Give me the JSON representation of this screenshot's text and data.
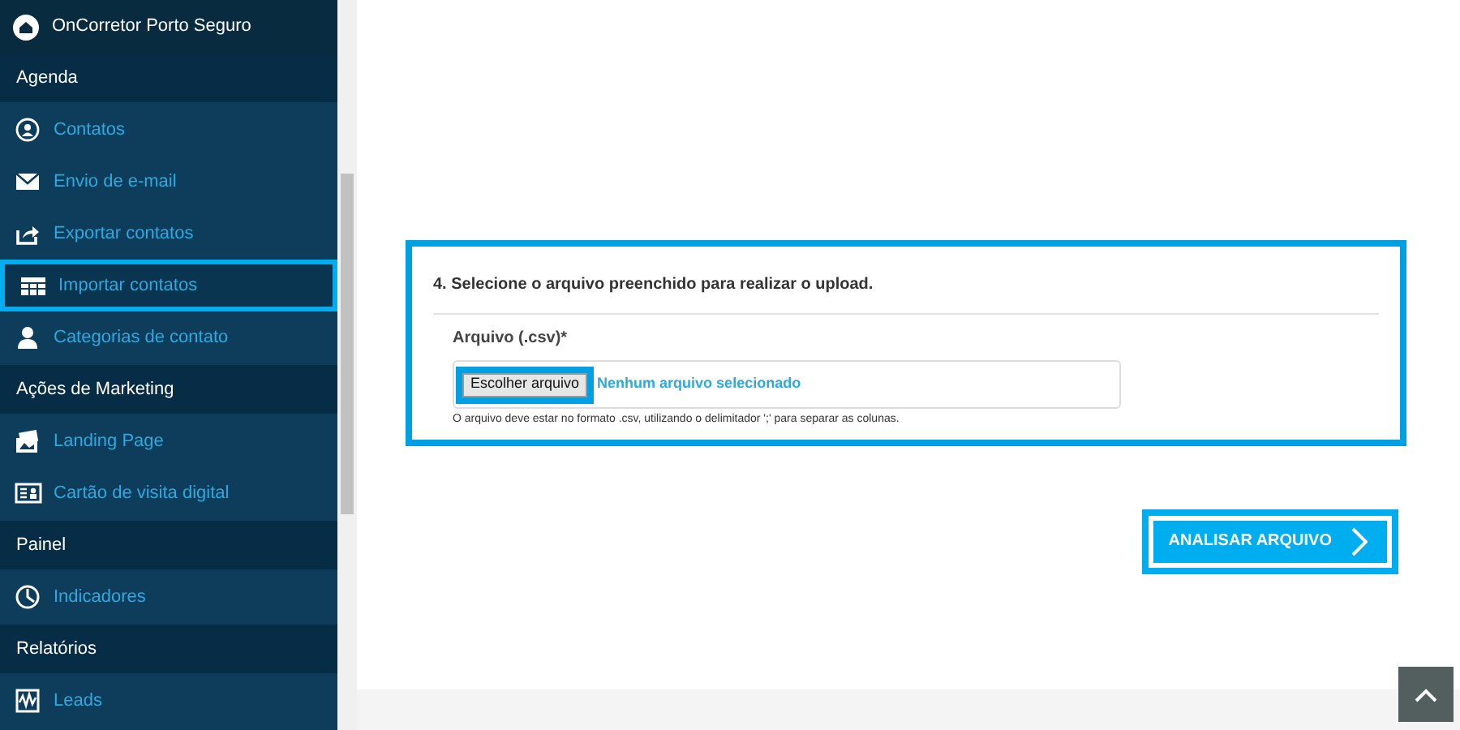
{
  "sidebar": {
    "title": "OnCorretor Porto Seguro",
    "groups": [
      {
        "label": "Agenda",
        "items": [
          {
            "label": "Contatos",
            "kind": "contacts",
            "highlighted": false
          },
          {
            "label": "Envio de e-mail",
            "kind": "email",
            "highlighted": false
          },
          {
            "label": "Exportar contatos",
            "kind": "export",
            "highlighted": false
          },
          {
            "label": "Importar contatos",
            "kind": "import",
            "highlighted": true
          },
          {
            "label": "Categorias de contato",
            "kind": "categories",
            "highlighted": false
          }
        ]
      },
      {
        "label": "Ações de Marketing",
        "items": [
          {
            "label": "Landing Page",
            "kind": "landing",
            "highlighted": false
          },
          {
            "label": "Cartão de visita digital",
            "kind": "card",
            "highlighted": false
          }
        ]
      },
      {
        "label": "Painel",
        "items": [
          {
            "label": "Indicadores",
            "kind": "indicators",
            "highlighted": false
          }
        ]
      },
      {
        "label": "Relatórios",
        "items": [
          {
            "label": "Leads",
            "kind": "leads",
            "highlighted": false
          }
        ]
      }
    ]
  },
  "upload_section": {
    "title": "4. Selecione o arquivo preenchido para realizar o upload.",
    "highlighted": true,
    "field_label": "Arquivo (.csv)*",
    "file_button": {
      "label": "Escolher arquivo",
      "highlighted": true
    },
    "file_status": "Nenhum arquivo selecionado",
    "hint": "O arquivo deve estar no formato .csv, utilizando o delimitador ';' para separar as colunas."
  },
  "analyze_button": {
    "label": "ANALISAR ARQUIVO",
    "highlighted": true
  }
}
